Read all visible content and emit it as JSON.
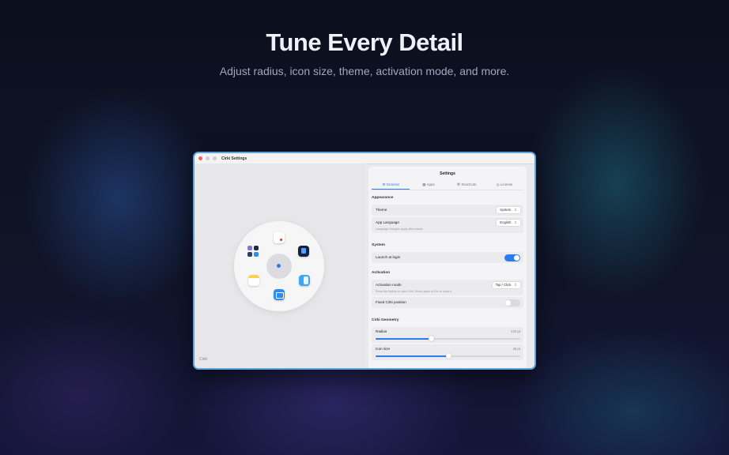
{
  "hero": {
    "title": "Tune Every Detail",
    "subtitle": "Adjust radius, icon size, theme, activation mode, and more."
  },
  "window": {
    "title": "Cirki Settings",
    "left_label": "Cirki"
  },
  "settings": {
    "title": "Settings",
    "tabs": [
      {
        "icon": "gear-icon",
        "label": "General",
        "active": true
      },
      {
        "icon": "grid-icon",
        "label": "Apps",
        "active": false
      },
      {
        "icon": "keyboard-icon",
        "label": "Shortcuts",
        "active": false
      },
      {
        "icon": "license-icon",
        "label": "License",
        "active": false
      }
    ],
    "appearance": {
      "header": "Appearance",
      "theme_label": "Theme",
      "theme_value": "System",
      "language_label": "App Language",
      "language_value": "English",
      "language_hint": "Language changes apply after restart."
    },
    "system": {
      "header": "System",
      "launch_label": "Launch at login",
      "launch_on": true
    },
    "activation": {
      "header": "Activation",
      "mode_label": "Activation mode",
      "mode_value": "Tap / Click",
      "mode_hint": "Press the hotkey to open Cirki. Press again or Esc to close it.",
      "fixed_label": "Fixed Cirki position",
      "fixed_on": false
    },
    "geometry": {
      "header": "Cirki Geometry",
      "radius_label": "Radius",
      "radius_value": "140 pt",
      "radius_fraction": 0.38,
      "icon_label": "Icon size",
      "icon_value": "46 pt",
      "icon_fraction": 0.5
    }
  },
  "colors": {
    "accent": "#2b7bf3",
    "window_border": "#5fa3d8"
  }
}
